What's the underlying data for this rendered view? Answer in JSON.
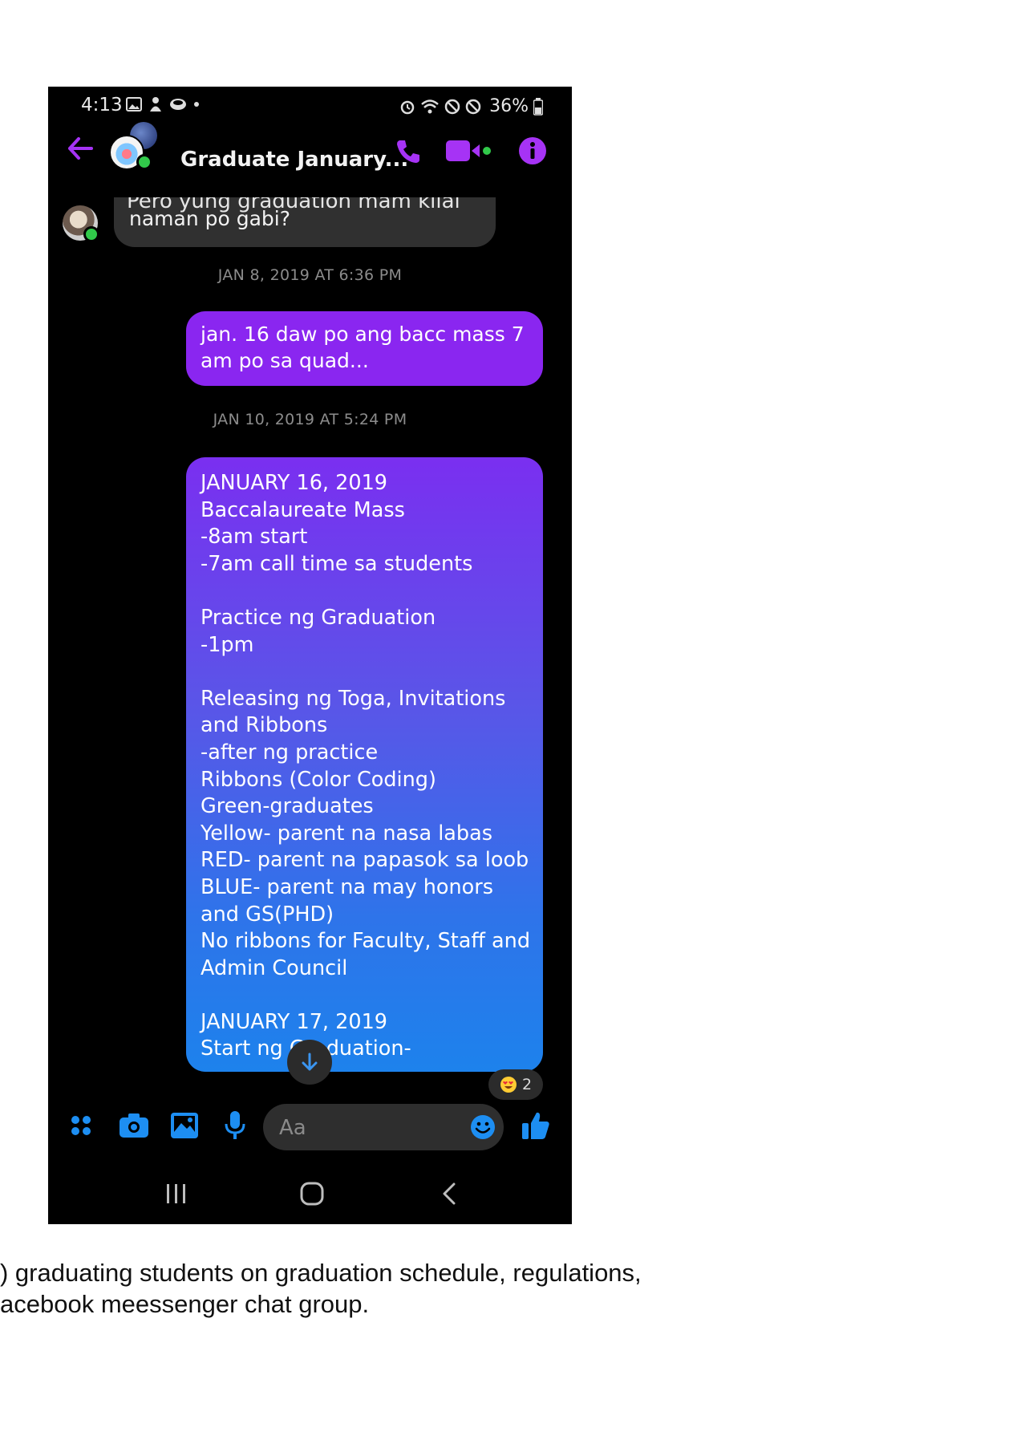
{
  "status_bar": {
    "time": "4:13",
    "battery": "36%"
  },
  "header": {
    "title": "Graduate January..."
  },
  "messages": {
    "clipped_top_text": "Pero yung graduation mam kilai",
    "incoming_text": "naman po gabi?",
    "timestamp_1": "JAN 8, 2019 AT 6:36 PM",
    "outgoing_1": "jan. 16 daw po ang bacc mass 7 am po sa quad...",
    "timestamp_2": "JAN 10, 2019 AT 5:24 PM",
    "outgoing_2_lines": [
      "JANUARY 16, 2019",
      "Baccalaureate Mass",
      "-8am start",
      "-7am call time sa students",
      "",
      "Practice ng Graduation",
      "-1pm",
      "",
      "Releasing ng Toga, Invitations",
      "and Ribbons",
      "-after ng practice",
      "Ribbons (Color Coding)",
      "Green-graduates",
      "Yellow- parent na nasa labas",
      "RED- parent na papasok sa loob",
      "BLUE- parent na may honors",
      "and GS(PHD)",
      "No ribbons for Faculty, Staff and",
      "Admin Council",
      "",
      "JANUARY 17, 2019",
      "Start ng Graduation-"
    ],
    "reaction_count": "2"
  },
  "composer": {
    "placeholder": "Aa"
  },
  "caption": {
    "line1": ") graduating students on graduation schedule, regulations,",
    "line2": "acebook meessenger chat group."
  },
  "colors": {
    "accent": "#a633f5",
    "bubble_top": "#7a2ff0",
    "bubble_bottom": "#1d82ec",
    "icon_blue": "#1d8ef2",
    "online": "#31c94a"
  },
  "icons": [
    "back-arrow-icon",
    "phone-icon",
    "video-icon",
    "info-icon",
    "menu-dots-icon",
    "camera-icon",
    "gallery-icon",
    "microphone-icon",
    "emoji-icon",
    "thumbs-up-icon",
    "scroll-down-icon",
    "recents-icon",
    "home-icon",
    "nav-back-icon"
  ]
}
